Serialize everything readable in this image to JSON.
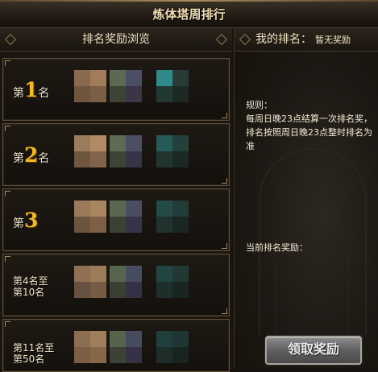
{
  "window": {
    "title": "炼体塔周排行"
  },
  "left_panel": {
    "header": "排名奖励浏览",
    "rows": [
      {
        "prefix": "第",
        "number": "1",
        "suffix": "名"
      },
      {
        "prefix": "第",
        "number": "2",
        "suffix": "名"
      },
      {
        "prefix": "第",
        "number": "3",
        "suffix": ""
      },
      {
        "line1": "第4名至",
        "line2": "第10名"
      },
      {
        "line1": "第11名至",
        "line2": "第50名"
      }
    ]
  },
  "right_panel": {
    "header": "我的排名：",
    "rank_status": "暂无奖励",
    "rules_title": "规则：",
    "rules_line1": "每周日晚23点结算一次排名奖，",
    "rules_line2": "排名按照周日晚23点整时排名为",
    "rules_line3": "准",
    "current_reward_label": "当前排名奖励：",
    "claim_button": "领取奖励"
  },
  "colors": {
    "rank_number": "#f4b81f",
    "panel_border": "#5f4e37",
    "background": "#17130e"
  }
}
